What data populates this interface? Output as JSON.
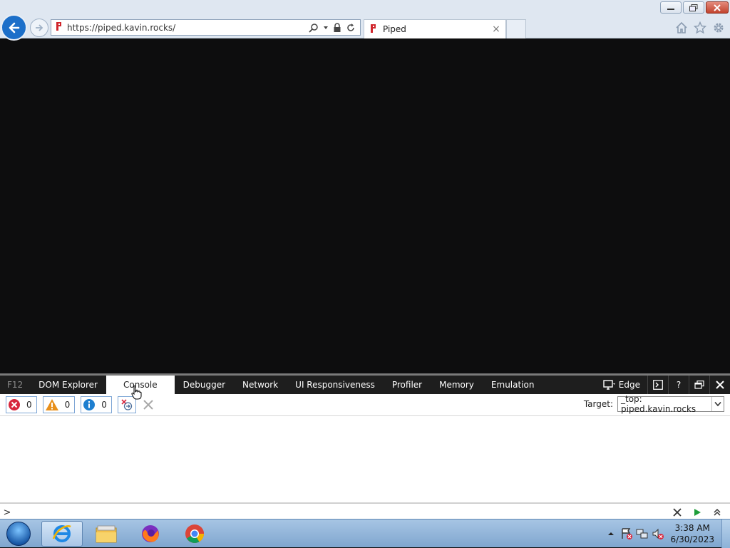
{
  "browser": {
    "address_url": "https://piped.kavin.rocks/",
    "tab_title": "Piped",
    "tab_close": "×"
  },
  "devtools": {
    "f12_label": "F12",
    "tabs": [
      {
        "label": "DOM Explorer"
      },
      {
        "label": "Console"
      },
      {
        "label": "Debugger"
      },
      {
        "label": "Network"
      },
      {
        "label": "UI Responsiveness"
      },
      {
        "label": "Profiler"
      },
      {
        "label": "Memory"
      },
      {
        "label": "Emulation"
      }
    ],
    "active_tab": "Console",
    "document_mode": "Edge",
    "help_label": "?",
    "counters": {
      "errors": "0",
      "warnings": "0",
      "info": "0"
    },
    "target_label": "Target:",
    "target_value": "_top: piped.kavin.rocks",
    "prompt_symbol": ">"
  },
  "taskbar": {
    "time": "3:38 AM",
    "date": "6/30/2023"
  },
  "colors": {
    "viewport_bg": "#0d0d0e",
    "devtools_tabbar": "#1e1e1e",
    "ie_blue": "#1c6fc9",
    "error_red": "#d7263d",
    "warning_orange": "#e8901c",
    "info_blue": "#1e7fd0",
    "run_green": "#1e9e3a"
  },
  "icons": {
    "back": "back-arrow-icon",
    "forward": "forward-arrow-icon",
    "favicon": "piped-favicon-icon",
    "search": "search-icon",
    "lock": "lock-icon",
    "refresh": "refresh-icon",
    "home": "home-icon",
    "favorites": "star-icon",
    "settings": "gear-icon"
  }
}
